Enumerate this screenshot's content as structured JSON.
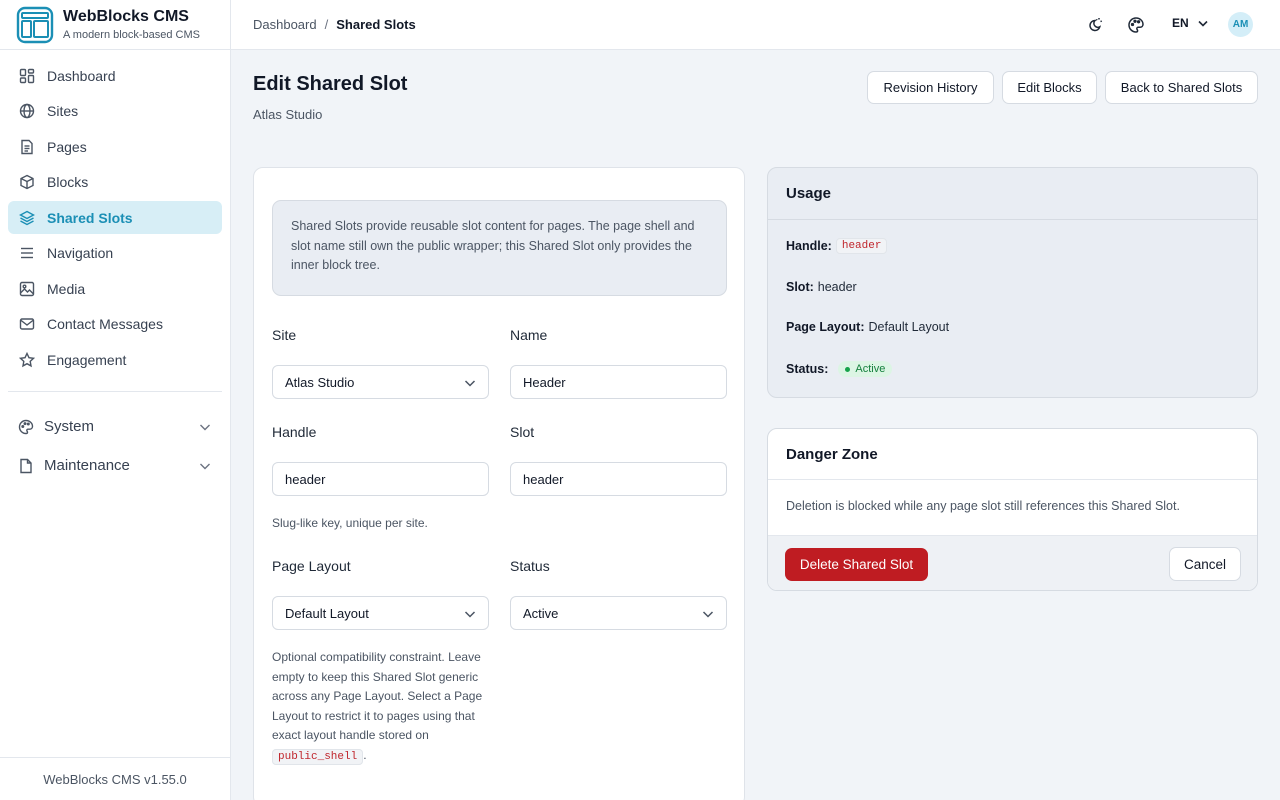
{
  "brand": {
    "title": "WebBlocks CMS",
    "subtitle": "A modern block-based CMS"
  },
  "sidebar": {
    "items": [
      {
        "label": "Dashboard",
        "icon": "dashboard-icon"
      },
      {
        "label": "Sites",
        "icon": "globe-icon"
      },
      {
        "label": "Pages",
        "icon": "page-icon"
      },
      {
        "label": "Blocks",
        "icon": "cube-icon"
      },
      {
        "label": "Shared Slots",
        "icon": "layers-icon",
        "active": true
      },
      {
        "label": "Navigation",
        "icon": "menu-icon"
      },
      {
        "label": "Media",
        "icon": "image-icon"
      },
      {
        "label": "Contact Messages",
        "icon": "mail-icon"
      },
      {
        "label": "Engagement",
        "icon": "star-icon"
      }
    ],
    "groups": [
      {
        "label": "System",
        "icon": "palette-icon"
      },
      {
        "label": "Maintenance",
        "icon": "file-icon"
      }
    ],
    "footer": "WebBlocks CMS v1.55.0"
  },
  "topbar": {
    "breadcrumb": [
      "Dashboard",
      "Shared Slots"
    ],
    "separator": "/",
    "lang": "EN",
    "avatar": "AM"
  },
  "page": {
    "title": "Edit Shared Slot",
    "subtitle": "Atlas Studio",
    "actions": {
      "revision_history": "Revision History",
      "edit_blocks": "Edit Blocks",
      "back": "Back to Shared Slots"
    }
  },
  "form": {
    "info": "Shared Slots provide reusable slot content for pages. The page shell and slot name still own the public wrapper; this Shared Slot only provides the inner block tree.",
    "site": {
      "label": "Site",
      "value": "Atlas Studio"
    },
    "name": {
      "label": "Name",
      "value": "Header"
    },
    "handle": {
      "label": "Handle",
      "value": "header",
      "hint": "Slug-like key, unique per site."
    },
    "slot": {
      "label": "Slot",
      "value": "header"
    },
    "page_layout": {
      "label": "Page Layout",
      "value": "Default Layout",
      "hint": "Optional compatibility constraint. Leave empty to keep this Shared Slot generic across any Page Layout. Select a Page Layout to restrict it to pages using that exact layout handle stored on",
      "hint_code": "public_shell",
      "hint_end": "."
    },
    "status": {
      "label": "Status",
      "value": "Active"
    }
  },
  "usage": {
    "title": "Usage",
    "handle_label": "Handle:",
    "handle_value": "header",
    "slot_label": "Slot:",
    "slot_value": "header",
    "layout_label": "Page Layout:",
    "layout_value": "Default Layout",
    "status_label": "Status:",
    "status_value": "Active"
  },
  "danger": {
    "title": "Danger Zone",
    "text": "Deletion is blocked while any page slot still references this Shared Slot.",
    "delete_label": "Delete Shared Slot",
    "cancel_label": "Cancel"
  },
  "colors": {
    "accent": "#1b8fb5",
    "accent_bg": "#d7eef6",
    "danger": "#bf1c22",
    "success": "#15803d"
  }
}
